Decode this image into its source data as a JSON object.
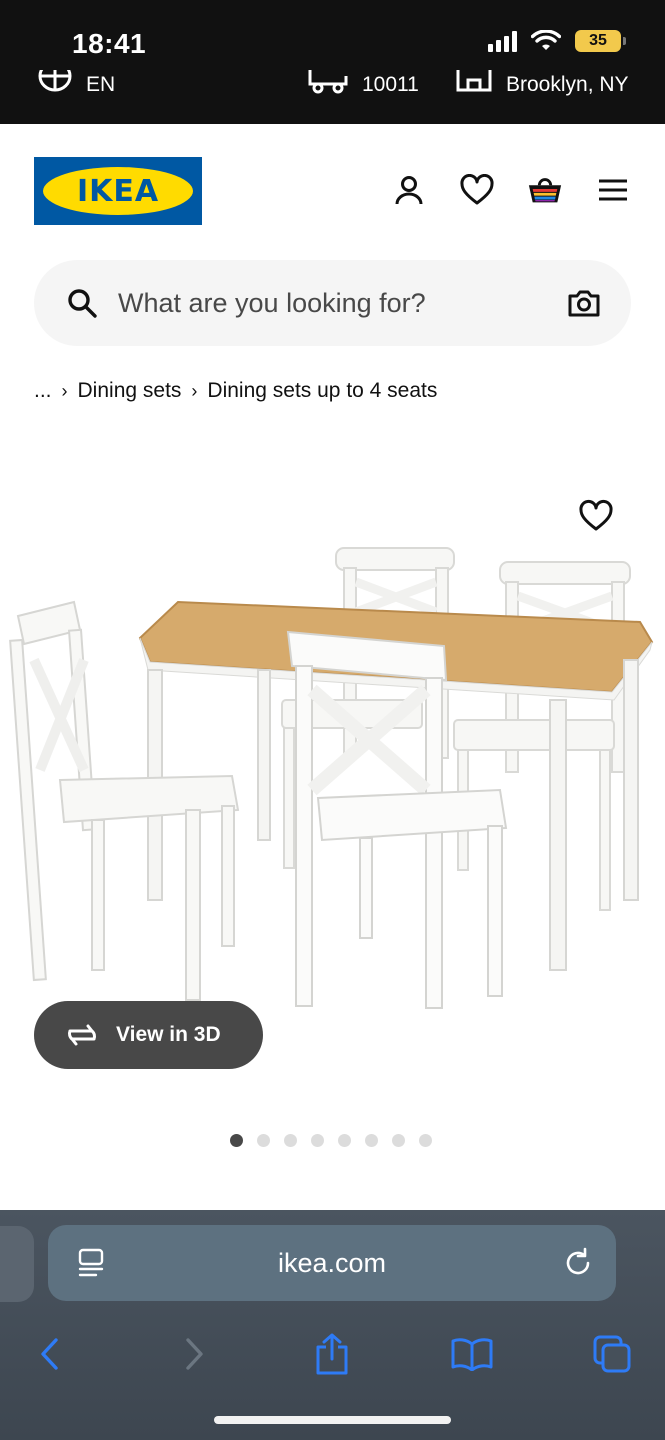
{
  "status": {
    "time": "18:41",
    "battery": "35"
  },
  "strip": {
    "language": "EN",
    "zip": "10011",
    "store": "Brooklyn, NY"
  },
  "brand": {
    "logo_text": "IKEA",
    "blue": "#0058a3",
    "yellow": "#ffdb00"
  },
  "header": {
    "icons": [
      "account-icon",
      "heart-icon",
      "cart-icon",
      "menu-icon"
    ]
  },
  "search": {
    "placeholder": "What are you looking for?"
  },
  "breadcrumb": {
    "ellipsis": "...",
    "items": [
      "Dining sets",
      "Dining sets up to 4 seats"
    ]
  },
  "product": {
    "view_3d_label": "View in 3D",
    "image_count": 8,
    "active_image": 1
  },
  "browser": {
    "url": "ikea.com"
  }
}
